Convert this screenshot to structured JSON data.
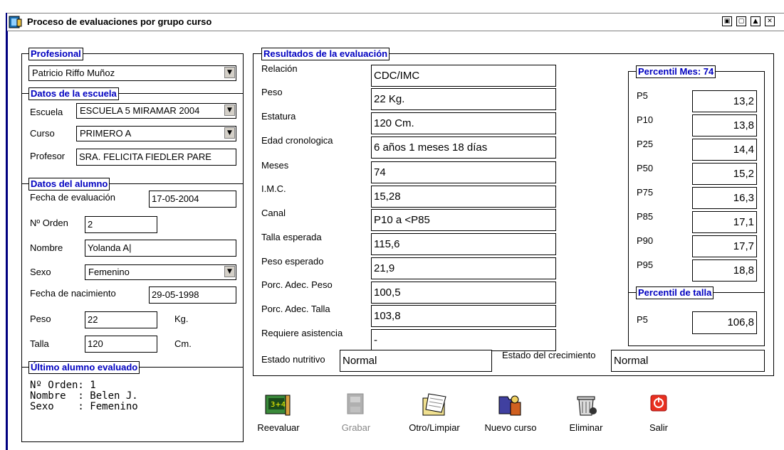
{
  "window": {
    "title": "Proceso de evaluaciones por grupo curso",
    "buttons": [
      "▣",
      "▢",
      "▲",
      "✕"
    ]
  },
  "profesional": {
    "legend": "Profesional",
    "value": "Patricio Riffo Muñoz"
  },
  "escuela": {
    "legend": "Datos de la escuela",
    "escuela_label": "Escuela",
    "escuela_value": "ESCUELA 5 MIRAMAR 2004",
    "curso_label": "Curso",
    "curso_value": "PRIMERO A",
    "profesor_label": "Profesor",
    "profesor_value": "SRA. FELICITA FIEDLER PARE"
  },
  "alumno": {
    "legend": "Datos del alumno",
    "fecha_eval_label": "Fecha de evaluación",
    "fecha_eval_value": "17-05-2004",
    "orden_label": "Nº Orden",
    "orden_value": "2",
    "nombre_label": "Nombre",
    "nombre_value": "Yolanda A|",
    "sexo_label": "Sexo",
    "sexo_value": "Femenino",
    "fecha_nac_label": "Fecha de nacimiento",
    "fecha_nac_value": "29-05-1998",
    "peso_label": "Peso",
    "peso_value": "22",
    "peso_unit": "Kg.",
    "talla_label": "Talla",
    "talla_value": "120",
    "talla_unit": "Cm."
  },
  "ultimo": {
    "legend": "Último alumno evaluado",
    "line1": "Nº Orden: 1",
    "line2": "Nombre  : Belen J.",
    "line3": "Sexo    : Femenino"
  },
  "resultados": {
    "legend": "Resultados de la evaluación",
    "rows": [
      {
        "label": "Relación",
        "value": "CDC/IMC"
      },
      {
        "label": "Peso",
        "value": "22 Kg."
      },
      {
        "label": "Estatura",
        "value": "120 Cm."
      },
      {
        "label": "Edad cronologica",
        "value": "6 años 1 meses 18 días"
      },
      {
        "label": "Meses",
        "value": "74"
      },
      {
        "label": "I.M.C.",
        "value": "15,28"
      },
      {
        "label": "Canal",
        "value": "P10 a <P85"
      },
      {
        "label": "Talla esperada",
        "value": "115,6"
      },
      {
        "label": "Peso esperado",
        "value": "21,9"
      },
      {
        "label": "Porc. Adec. Peso",
        "value": "100,5"
      },
      {
        "label": "Porc. Adec. Talla",
        "value": "103,8"
      },
      {
        "label": "Requiere asistencia",
        "value": "-"
      }
    ],
    "estado_nutritivo_label": "Estado nutritivo",
    "estado_nutritivo_value": "Normal",
    "estado_crecimiento_label": "Estado del crecimiento",
    "estado_crecimiento_value": "Normal"
  },
  "percentil_mes": {
    "legend": "Percentil Mes: 74",
    "rows": [
      {
        "label": "P5",
        "value": "13,2"
      },
      {
        "label": "P10",
        "value": "13,8"
      },
      {
        "label": "P25",
        "value": "14,4"
      },
      {
        "label": "P50",
        "value": "15,2"
      },
      {
        "label": "P75",
        "value": "16,3"
      },
      {
        "label": "P85",
        "value": "17,1"
      },
      {
        "label": "P90",
        "value": "17,7"
      },
      {
        "label": "P95",
        "value": "18,8"
      }
    ]
  },
  "percentil_talla": {
    "legend": "Percentil de talla",
    "label": "P5",
    "value": "106,8"
  },
  "toolbar": {
    "reevaluar": "Reevaluar",
    "grabar": "Grabar",
    "otro": "Otro/Limpiar",
    "nuevo": "Nuevo curso",
    "eliminar": "Eliminar",
    "salir": "Salir"
  }
}
